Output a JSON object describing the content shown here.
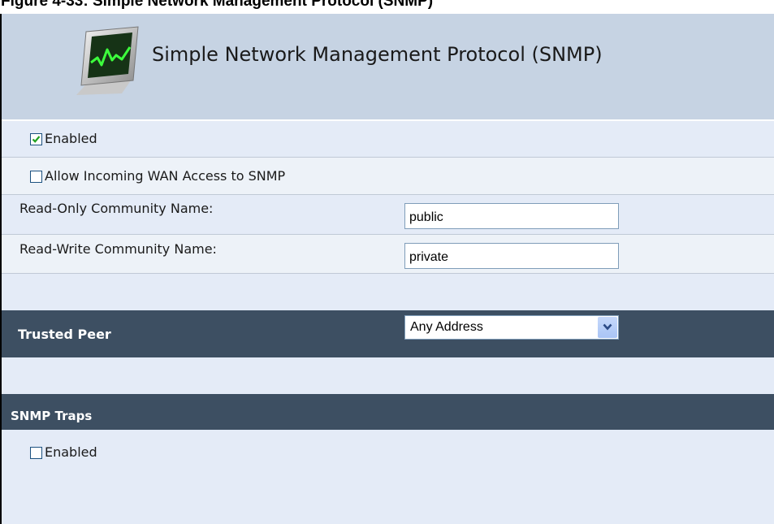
{
  "caption": "Figure 4-33: Simple Network Management Protocol (SNMP)",
  "header": {
    "title": "Simple Network Management Protocol (SNMP)",
    "icon": "monitor-graph-icon"
  },
  "snmp": {
    "enabled_label": "Enabled",
    "enabled_checked": true,
    "wan_access_label": "Allow Incoming WAN Access to SNMP",
    "wan_access_checked": false,
    "read_only_label": "Read-Only Community Name:",
    "read_only_value": "public",
    "read_write_label": "Read-Write Community Name:",
    "read_write_value": "private"
  },
  "trusted_peer": {
    "label": "Trusted Peer",
    "selected": "Any Address"
  },
  "traps": {
    "title": "SNMP Traps",
    "enabled_label": "Enabled",
    "enabled_checked": false
  },
  "colors": {
    "header_bg": "#c6d3e3",
    "row_bg": "#e4ebf7",
    "section_bar": "#3d4f62",
    "check": "#21a121"
  }
}
